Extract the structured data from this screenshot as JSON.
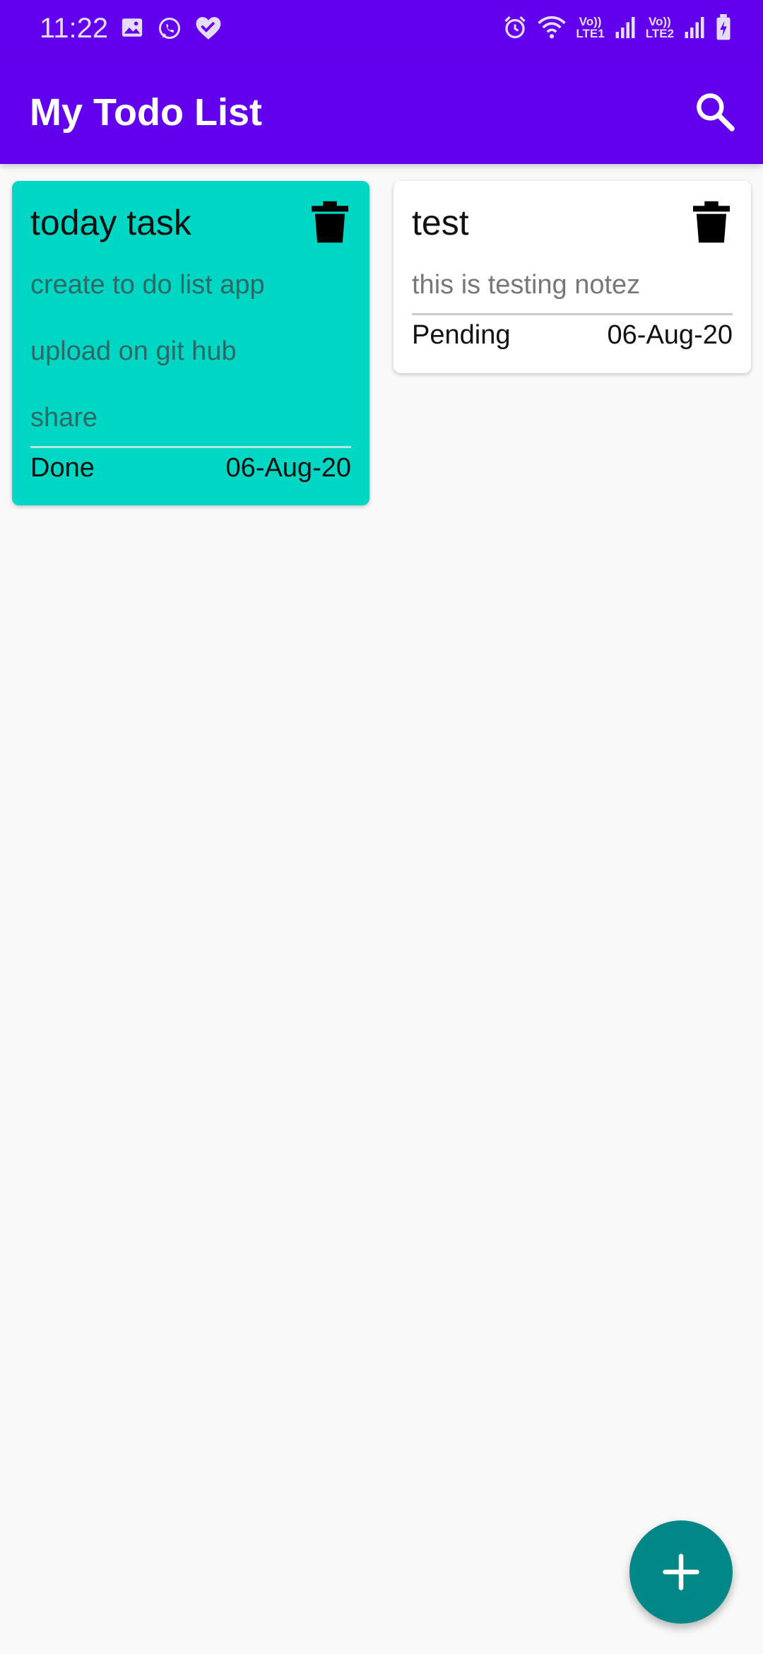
{
  "status_bar": {
    "time": "11:22",
    "left_icons": [
      "image-icon",
      "whatsapp-icon",
      "health-heart-icon"
    ],
    "right_icons": [
      "alarm-icon",
      "wifi-icon",
      "volte-lte1-icon",
      "signal-icon",
      "volte-lte2-icon",
      "signal-icon",
      "battery-charging-icon"
    ],
    "lte1_label": "LTE1",
    "lte2_label": "LTE2",
    "volte_label": "Vo))"
  },
  "app_bar": {
    "title": "My Todo List",
    "search_icon": "search-icon"
  },
  "cards": [
    {
      "title": "today task",
      "notes": [
        "create to do list app",
        "upload on git hub",
        "share"
      ],
      "status": "Done",
      "date": "06-Aug-20",
      "background": "#00d6c4"
    },
    {
      "title": "test",
      "notes": [
        "this is testing notez"
      ],
      "status": "Pending",
      "date": "06-Aug-20",
      "background": "#ffffff"
    }
  ],
  "fab": {
    "icon": "plus-icon"
  },
  "colors": {
    "primary": "#6200ee",
    "fab": "#018786",
    "done_card": "#00d6c4"
  }
}
